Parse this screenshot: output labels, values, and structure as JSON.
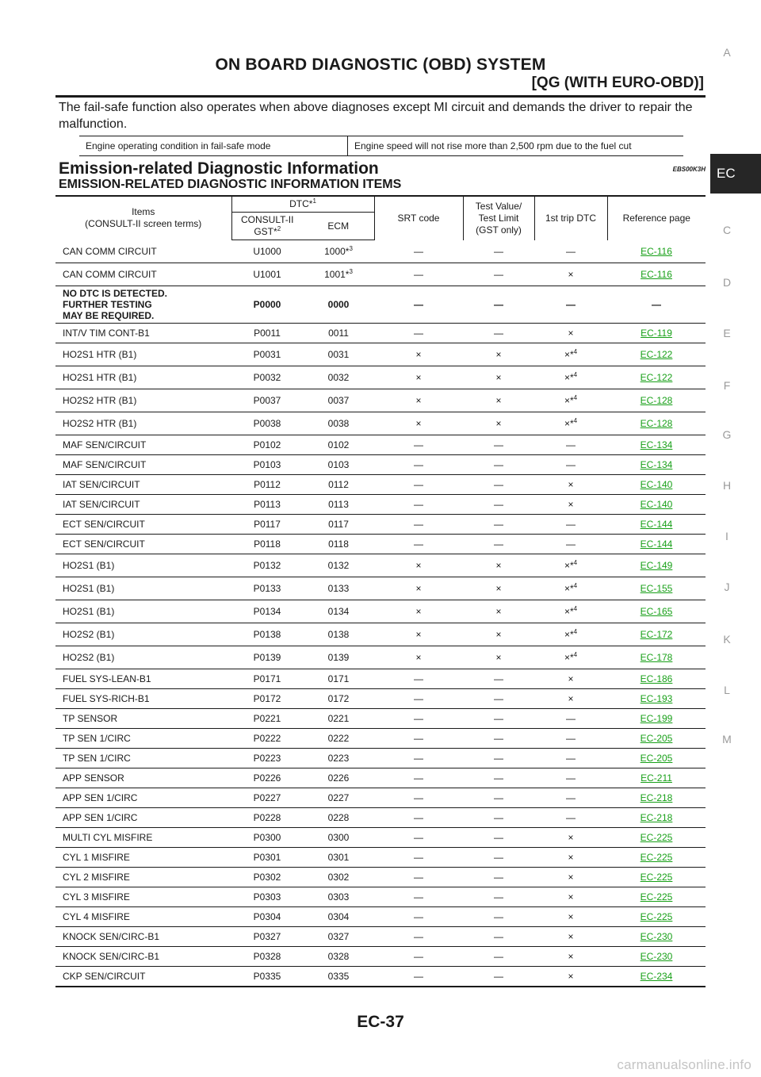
{
  "header": {
    "title": "ON BOARD DIAGNOSTIC (OBD) SYSTEM",
    "subtitle": "[QG (WITH EURO-OBD)]"
  },
  "intro_text": "The fail-safe function also operates when above diagnoses except MI circuit and demands the driver to repair the malfunction.",
  "failsafe_table": {
    "condition_label": "Engine operating condition in fail-safe mode",
    "condition_value": "Engine speed will not rise more than 2,500 rpm due to the fuel cut"
  },
  "section": {
    "title": "Emission-related Diagnostic Information",
    "code": "EBS00K3H",
    "subtitle": "EMISSION-RELATED DIAGNOSTIC INFORMATION ITEMS"
  },
  "dtc_table": {
    "headers": {
      "items_line1": "Items",
      "items_line2": "(CONSULT-II screen terms)",
      "dtc": "DTC*",
      "dtc_note": "1",
      "consult_line1": "CONSULT-II",
      "consult_line2": "GST*",
      "consult_note": "2",
      "ecm": "ECM",
      "srt": "SRT code",
      "test_line1": "Test Value/",
      "test_line2": "Test Limit",
      "test_line3": "(GST only)",
      "trip": "1st trip DTC",
      "ref": "Reference page"
    },
    "rows": [
      {
        "item": "CAN COMM CIRCUIT",
        "consult": "U1000",
        "ecm": "1000*",
        "ecm_note": "3",
        "srt": "—",
        "test": "—",
        "trip": "—",
        "trip_note": "",
        "ref": "EC-116"
      },
      {
        "item": "CAN COMM CIRCUIT",
        "consult": "U1001",
        "ecm": "1001*",
        "ecm_note": "3",
        "srt": "—",
        "test": "—",
        "trip": "×",
        "trip_note": "",
        "ref": "EC-116"
      },
      {
        "item_lines": [
          "NO DTC IS DETECTED.",
          "FURTHER TESTING",
          "MAY BE REQUIRED."
        ],
        "consult": "P0000",
        "ecm": "0000",
        "ecm_note": "",
        "srt": "—",
        "test": "—",
        "trip": "—",
        "trip_note": "",
        "ref": "—"
      },
      {
        "item": "INT/V TIM CONT-B1",
        "consult": "P0011",
        "ecm": "0011",
        "ecm_note": "",
        "srt": "—",
        "test": "—",
        "trip": "×",
        "trip_note": "",
        "ref": "EC-119"
      },
      {
        "item": "HO2S1 HTR (B1)",
        "consult": "P0031",
        "ecm": "0031",
        "ecm_note": "",
        "srt": "×",
        "test": "×",
        "trip": "×*",
        "trip_note": "4",
        "ref": "EC-122"
      },
      {
        "item": "HO2S1 HTR (B1)",
        "consult": "P0032",
        "ecm": "0032",
        "ecm_note": "",
        "srt": "×",
        "test": "×",
        "trip": "×*",
        "trip_note": "4",
        "ref": "EC-122"
      },
      {
        "item": "HO2S2 HTR (B1)",
        "consult": "P0037",
        "ecm": "0037",
        "ecm_note": "",
        "srt": "×",
        "test": "×",
        "trip": "×*",
        "trip_note": "4",
        "ref": "EC-128"
      },
      {
        "item": "HO2S2 HTR (B1)",
        "consult": "P0038",
        "ecm": "0038",
        "ecm_note": "",
        "srt": "×",
        "test": "×",
        "trip": "×*",
        "trip_note": "4",
        "ref": "EC-128"
      },
      {
        "item": "MAF SEN/CIRCUIT",
        "consult": "P0102",
        "ecm": "0102",
        "ecm_note": "",
        "srt": "—",
        "test": "—",
        "trip": "—",
        "trip_note": "",
        "ref": "EC-134"
      },
      {
        "item": "MAF SEN/CIRCUIT",
        "consult": "P0103",
        "ecm": "0103",
        "ecm_note": "",
        "srt": "—",
        "test": "—",
        "trip": "—",
        "trip_note": "",
        "ref": "EC-134"
      },
      {
        "item": "IAT SEN/CIRCUIT",
        "consult": "P0112",
        "ecm": "0112",
        "ecm_note": "",
        "srt": "—",
        "test": "—",
        "trip": "×",
        "trip_note": "",
        "ref": "EC-140"
      },
      {
        "item": "IAT SEN/CIRCUIT",
        "consult": "P0113",
        "ecm": "0113",
        "ecm_note": "",
        "srt": "—",
        "test": "—",
        "trip": "×",
        "trip_note": "",
        "ref": "EC-140"
      },
      {
        "item": "ECT SEN/CIRCUIT",
        "consult": "P0117",
        "ecm": "0117",
        "ecm_note": "",
        "srt": "—",
        "test": "—",
        "trip": "—",
        "trip_note": "",
        "ref": "EC-144"
      },
      {
        "item": "ECT SEN/CIRCUIT",
        "consult": "P0118",
        "ecm": "0118",
        "ecm_note": "",
        "srt": "—",
        "test": "—",
        "trip": "—",
        "trip_note": "",
        "ref": "EC-144"
      },
      {
        "item": "HO2S1 (B1)",
        "consult": "P0132",
        "ecm": "0132",
        "ecm_note": "",
        "srt": "×",
        "test": "×",
        "trip": "×*",
        "trip_note": "4",
        "ref": "EC-149"
      },
      {
        "item": "HO2S1 (B1)",
        "consult": "P0133",
        "ecm": "0133",
        "ecm_note": "",
        "srt": "×",
        "test": "×",
        "trip": "×*",
        "trip_note": "4",
        "ref": "EC-155"
      },
      {
        "item": "HO2S1 (B1)",
        "consult": "P0134",
        "ecm": "0134",
        "ecm_note": "",
        "srt": "×",
        "test": "×",
        "trip": "×*",
        "trip_note": "4",
        "ref": "EC-165"
      },
      {
        "item": "HO2S2 (B1)",
        "consult": "P0138",
        "ecm": "0138",
        "ecm_note": "",
        "srt": "×",
        "test": "×",
        "trip": "×*",
        "trip_note": "4",
        "ref": "EC-172"
      },
      {
        "item": "HO2S2 (B1)",
        "consult": "P0139",
        "ecm": "0139",
        "ecm_note": "",
        "srt": "×",
        "test": "×",
        "trip": "×*",
        "trip_note": "4",
        "ref": "EC-178"
      },
      {
        "item": "FUEL SYS-LEAN-B1",
        "consult": "P0171",
        "ecm": "0171",
        "ecm_note": "",
        "srt": "—",
        "test": "—",
        "trip": "×",
        "trip_note": "",
        "ref": "EC-186"
      },
      {
        "item": "FUEL SYS-RICH-B1",
        "consult": "P0172",
        "ecm": "0172",
        "ecm_note": "",
        "srt": "—",
        "test": "—",
        "trip": "×",
        "trip_note": "",
        "ref": "EC-193"
      },
      {
        "item": "TP SENSOR",
        "consult": "P0221",
        "ecm": "0221",
        "ecm_note": "",
        "srt": "—",
        "test": "—",
        "trip": "—",
        "trip_note": "",
        "ref": "EC-199"
      },
      {
        "item": "TP SEN 1/CIRC",
        "consult": "P0222",
        "ecm": "0222",
        "ecm_note": "",
        "srt": "—",
        "test": "—",
        "trip": "—",
        "trip_note": "",
        "ref": "EC-205"
      },
      {
        "item": "TP SEN 1/CIRC",
        "consult": "P0223",
        "ecm": "0223",
        "ecm_note": "",
        "srt": "—",
        "test": "—",
        "trip": "—",
        "trip_note": "",
        "ref": "EC-205"
      },
      {
        "item": "APP SENSOR",
        "consult": "P0226",
        "ecm": "0226",
        "ecm_note": "",
        "srt": "—",
        "test": "—",
        "trip": "—",
        "trip_note": "",
        "ref": "EC-211"
      },
      {
        "item": "APP SEN 1/CIRC",
        "consult": "P0227",
        "ecm": "0227",
        "ecm_note": "",
        "srt": "—",
        "test": "—",
        "trip": "—",
        "trip_note": "",
        "ref": "EC-218"
      },
      {
        "item": "APP SEN 1/CIRC",
        "consult": "P0228",
        "ecm": "0228",
        "ecm_note": "",
        "srt": "—",
        "test": "—",
        "trip": "—",
        "trip_note": "",
        "ref": "EC-218"
      },
      {
        "item": "MULTI CYL MISFIRE",
        "consult": "P0300",
        "ecm": "0300",
        "ecm_note": "",
        "srt": "—",
        "test": "—",
        "trip": "×",
        "trip_note": "",
        "ref": "EC-225"
      },
      {
        "item": "CYL 1 MISFIRE",
        "consult": "P0301",
        "ecm": "0301",
        "ecm_note": "",
        "srt": "—",
        "test": "—",
        "trip": "×",
        "trip_note": "",
        "ref": "EC-225"
      },
      {
        "item": "CYL 2 MISFIRE",
        "consult": "P0302",
        "ecm": "0302",
        "ecm_note": "",
        "srt": "—",
        "test": "—",
        "trip": "×",
        "trip_note": "",
        "ref": "EC-225"
      },
      {
        "item": "CYL 3 MISFIRE",
        "consult": "P0303",
        "ecm": "0303",
        "ecm_note": "",
        "srt": "—",
        "test": "—",
        "trip": "×",
        "trip_note": "",
        "ref": "EC-225"
      },
      {
        "item": "CYL 4 MISFIRE",
        "consult": "P0304",
        "ecm": "0304",
        "ecm_note": "",
        "srt": "—",
        "test": "—",
        "trip": "×",
        "trip_note": "",
        "ref": "EC-225"
      },
      {
        "item": "KNOCK SEN/CIRC-B1",
        "consult": "P0327",
        "ecm": "0327",
        "ecm_note": "",
        "srt": "—",
        "test": "—",
        "trip": "×",
        "trip_note": "",
        "ref": "EC-230"
      },
      {
        "item": "KNOCK SEN/CIRC-B1",
        "consult": "P0328",
        "ecm": "0328",
        "ecm_note": "",
        "srt": "—",
        "test": "—",
        "trip": "×",
        "trip_note": "",
        "ref": "EC-230"
      },
      {
        "item": "CKP SEN/CIRCUIT",
        "consult": "P0335",
        "ecm": "0335",
        "ecm_note": "",
        "srt": "—",
        "test": "—",
        "trip": "×",
        "trip_note": "",
        "ref": "EC-234"
      }
    ]
  },
  "side_index": {
    "letters": [
      "A",
      "C",
      "D",
      "E",
      "F",
      "G",
      "H",
      "I",
      "J",
      "K",
      "L",
      "M"
    ],
    "active_tab": "EC"
  },
  "page_number": "EC-37",
  "watermark": "carmanualsonline.info",
  "colors": {
    "link": "#18a018",
    "tab_background": "#262626",
    "side_letter": "#9a9a9a",
    "watermark": "#c4c4c4"
  }
}
